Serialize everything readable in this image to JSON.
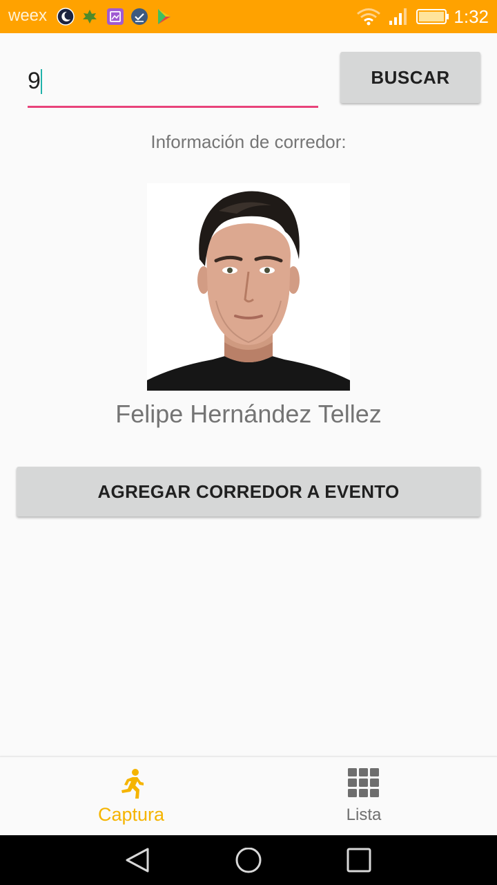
{
  "status_bar": {
    "carrier": "weex",
    "time": "1:32",
    "background": "#ffa200",
    "icons": [
      "moon-icon",
      "leaf-icon",
      "gallery-icon",
      "checklist-icon",
      "play-store-icon",
      "wifi-icon",
      "signal-icon",
      "battery-icon"
    ]
  },
  "search": {
    "value": "9",
    "button_label": "BUSCAR",
    "underline_color": "#e8437a"
  },
  "runner_info": {
    "label": "Información de corredor:",
    "name": "Felipe Hernández Tellez",
    "photo": "runner-photo"
  },
  "actions": {
    "add_runner_label": "AGREGAR CORREDOR A EVENTO"
  },
  "bottom_nav": {
    "items": [
      {
        "label": "Captura",
        "icon": "running-person-icon",
        "active": true
      },
      {
        "label": "Lista",
        "icon": "grid-icon",
        "active": false
      }
    ],
    "active_color": "#f5b400",
    "inactive_color": "#707070"
  },
  "system_nav": {
    "icons": [
      "back-icon",
      "home-icon",
      "recents-icon"
    ]
  }
}
